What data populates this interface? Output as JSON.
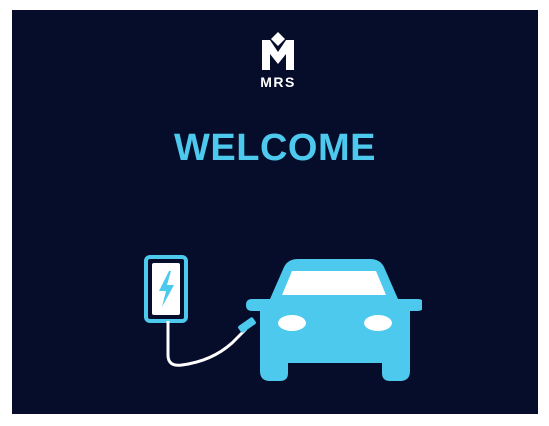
{
  "screen": {
    "background": "#060d2b",
    "accent": "#4dc9ee"
  },
  "logo": {
    "text": "MRS",
    "icon": "mrs-logo-icon"
  },
  "heading": {
    "text": "WELCOME"
  },
  "illustration": {
    "charger_icon": "ev-charger-icon",
    "bolt_icon": "lightning-bolt-icon",
    "car_icon": "car-front-icon"
  }
}
